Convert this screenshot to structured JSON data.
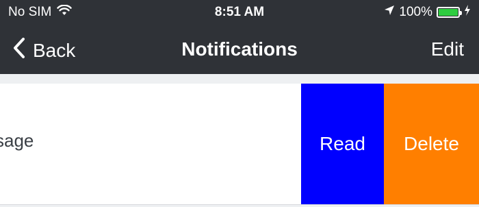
{
  "status_bar": {
    "carrier": "No SIM",
    "time": "8:51 AM",
    "battery": "100%",
    "icons": [
      "wifi-icon",
      "location-arrow-icon",
      "battery-icon",
      "charging-bolt-icon"
    ],
    "battery_color": "#2ecc40"
  },
  "navbar": {
    "back_label": "Back",
    "title": "Notifications",
    "edit_label": "Edit",
    "background": "#2f3237"
  },
  "notifications": {
    "rows": [
      {
        "message": "ssage",
        "actions": {
          "read_label": "Read",
          "read_color": "#0000ff",
          "delete_label": "Delete",
          "delete_color": "#ff7f00"
        }
      }
    ]
  }
}
